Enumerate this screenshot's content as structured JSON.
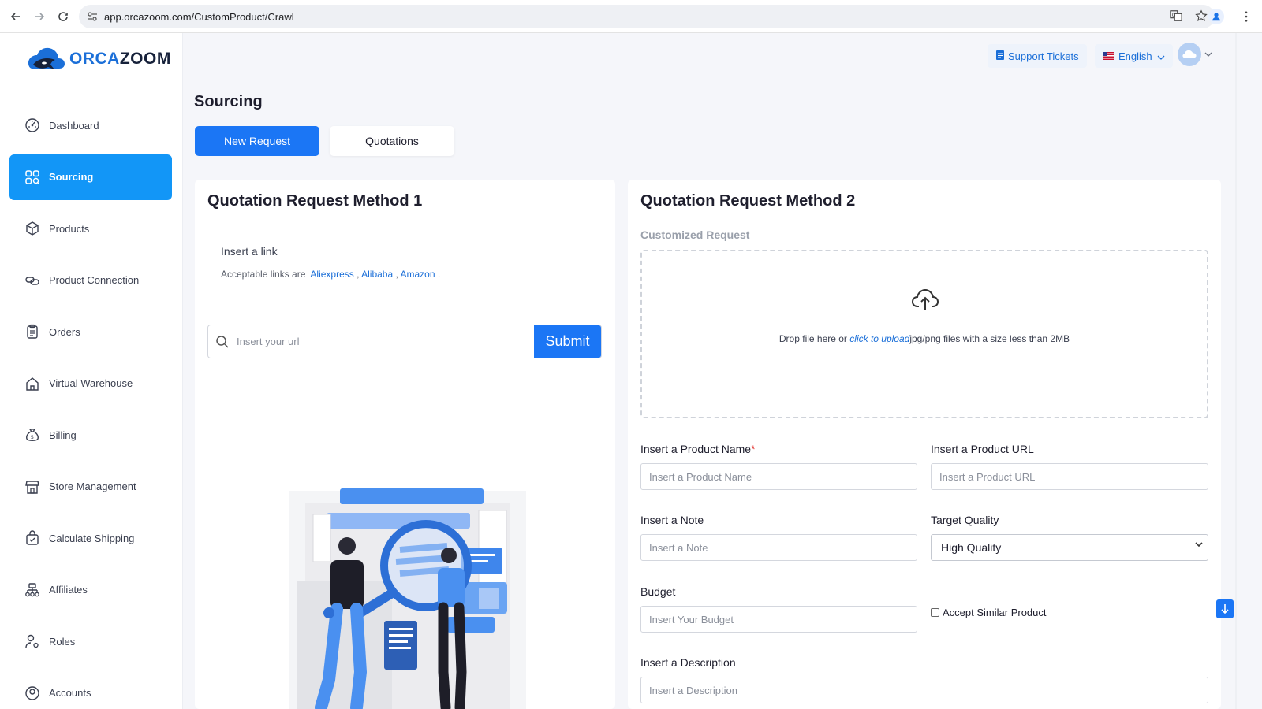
{
  "browser": {
    "url": "app.orcazoom.com/CustomProduct/Crawl"
  },
  "logo": {
    "orca": "ORCA",
    "zoom": "ZOOM"
  },
  "sidebar": {
    "items": [
      {
        "label": "Dashboard",
        "icon": "dashboard-icon"
      },
      {
        "label": "Sourcing",
        "icon": "grid-search-icon",
        "active": true
      },
      {
        "label": "Products",
        "icon": "box-icon"
      },
      {
        "label": "Product Connection",
        "icon": "link-icon"
      },
      {
        "label": "Orders",
        "icon": "clipboard-icon"
      },
      {
        "label": "Virtual Warehouse",
        "icon": "home-icon"
      },
      {
        "label": "Billing",
        "icon": "money-bag-icon"
      },
      {
        "label": "Store Management",
        "icon": "store-icon"
      },
      {
        "label": "Calculate Shipping",
        "icon": "shopping-bag-icon"
      },
      {
        "label": "Affiliates",
        "icon": "hierarchy-icon"
      },
      {
        "label": "Roles",
        "icon": "user-settings-icon"
      },
      {
        "label": "Accounts",
        "icon": "account-icon"
      }
    ]
  },
  "header": {
    "support_label": "Support Tickets",
    "language_label": "English"
  },
  "page": {
    "title": "Sourcing",
    "tabs": {
      "new_request": "New Request",
      "quotations": "Quotations"
    }
  },
  "method1": {
    "title": "Quotation Request Method 1",
    "insert_link": "Insert a link",
    "acceptable_prefix": "Acceptable links are",
    "links": [
      "Aliexpress",
      "Alibaba",
      "Amazon"
    ],
    "url_placeholder": "Insert your url",
    "submit_label": "Submit"
  },
  "method2": {
    "title": "Quotation Request Method 2",
    "subtitle": "Customized Request",
    "drop_prefix": "Drop file here or",
    "drop_link": "click to upload",
    "drop_suffix": "jpg/png files with a size less than 2MB",
    "product_name_label": "Insert a Product Name",
    "product_name_placeholder": "Insert a Product Name",
    "product_url_label": "Insert a Product URL",
    "product_url_placeholder": "Insert a Product URL",
    "note_label": "Insert a Note",
    "note_placeholder": "Insert a Note",
    "quality_label": "Target Quality",
    "quality_value": "High Quality",
    "budget_label": "Budget",
    "budget_placeholder": "Insert Your Budget",
    "similar_label": "Accept Similar Product",
    "description_label": "Insert a Description",
    "description_placeholder": "Insert a Description"
  },
  "colors": {
    "primary": "#1b76f5",
    "sidebar_active": "#1296f7",
    "link": "#1b6fd8"
  }
}
